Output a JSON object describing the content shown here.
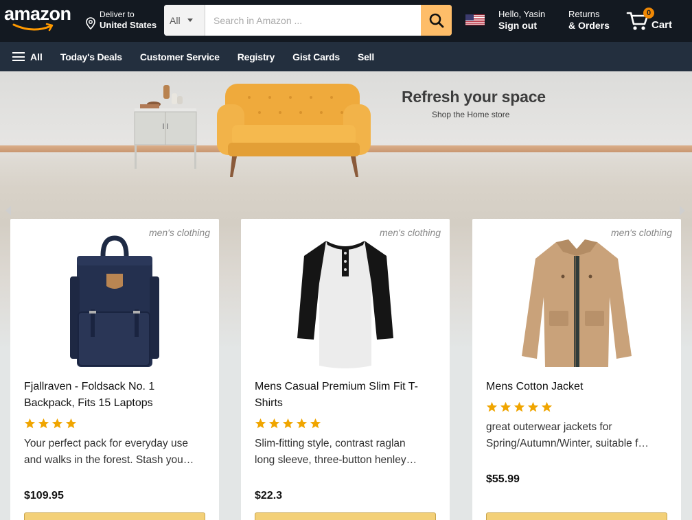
{
  "header": {
    "logo_text": "amazon",
    "deliver_line1": "Deliver to",
    "deliver_line2": "United States",
    "search": {
      "category": "All",
      "placeholder": "Search in Amazon ..."
    },
    "account_line1": "Hello, Yasin",
    "account_line2": "Sign out",
    "returns_line1": "Returns",
    "returns_line2": "& Orders",
    "cart_count": "0",
    "cart_label": "Cart"
  },
  "nav": {
    "all_label": "All",
    "items": [
      "Today's Deals",
      "Customer Service",
      "Registry",
      "Gist Cards",
      "Sell"
    ]
  },
  "hero": {
    "title": "Refresh your space",
    "subtitle": "Shop the Home store"
  },
  "products": [
    {
      "category": "men's clothing",
      "title_line1": "Fjallraven - Foldsack No. 1",
      "title_line2": "Backpack, Fits 15 Laptops",
      "rating": 4,
      "desc_line1": "Your perfect pack for everyday use",
      "desc_line2": "and walks in the forest. Stash you…",
      "price": "$109.95",
      "image": "backpack"
    },
    {
      "category": "men's clothing",
      "title_line1": "Mens Casual Premium Slim Fit T-",
      "title_line2": "Shirts",
      "rating": 5,
      "desc_line1": "Slim-fitting style, contrast raglan",
      "desc_line2": "long sleeve, three-button henley…",
      "price": "$22.3",
      "image": "raglan-shirt"
    },
    {
      "category": "men's clothing",
      "title_line1": "Mens Cotton Jacket",
      "title_line2": "",
      "rating": 5,
      "desc_line1": "great outerwear jackets for",
      "desc_line2": "Spring/Autumn/Winter, suitable f…",
      "price": "$55.99",
      "image": "jacket"
    }
  ],
  "colors": {
    "header_bg": "#131921",
    "nav_bg": "#232f3e",
    "search_button": "#febd69",
    "star": "#f0a500",
    "cart_badge": "#f08804",
    "add_button": "#f3d078"
  }
}
